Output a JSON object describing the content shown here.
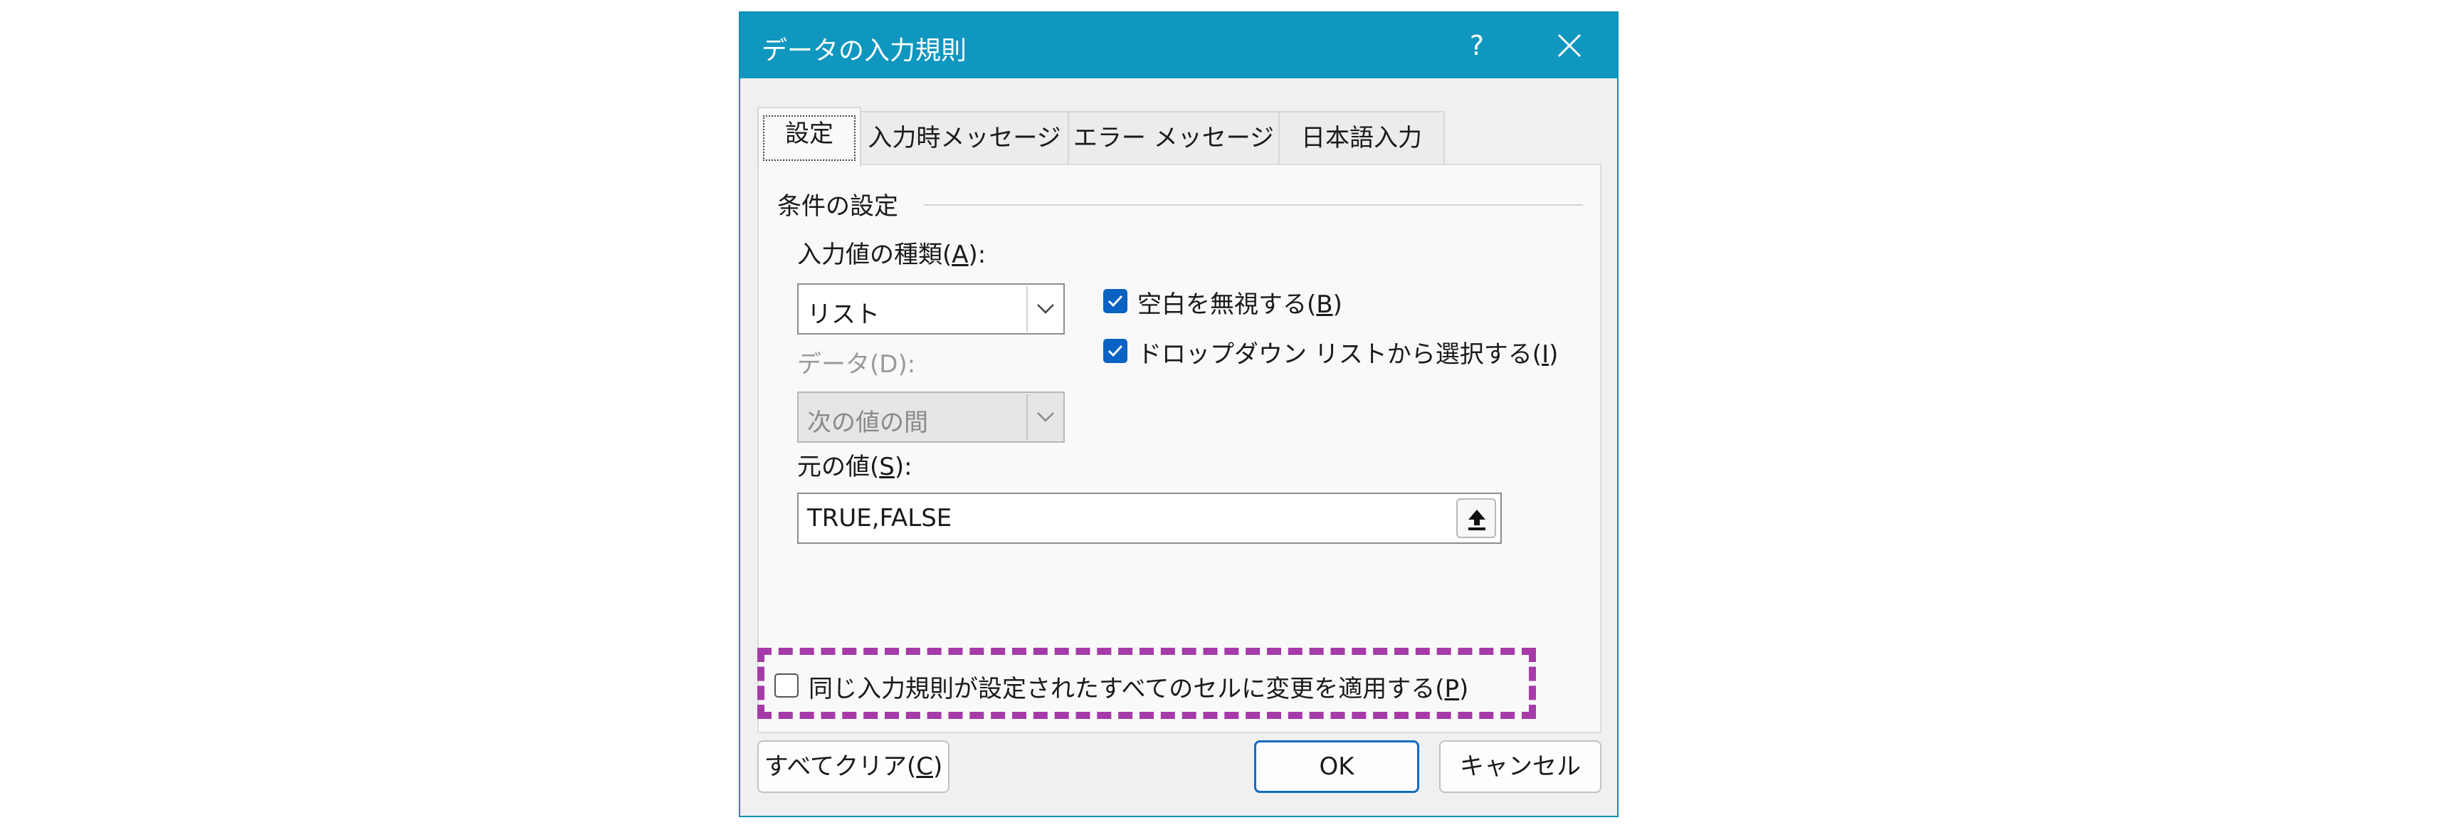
{
  "dialog": {
    "title": "データの入力規則",
    "help_label": "?",
    "close_label": "✕"
  },
  "tabs": [
    {
      "label": "設定",
      "active": true
    },
    {
      "label": "入力時メッセージ",
      "active": false
    },
    {
      "label": "エラー メッセージ",
      "active": false
    },
    {
      "label": "日本語入力",
      "active": false
    }
  ],
  "settings": {
    "group_label": "条件の設定",
    "allow": {
      "label": "入力値の種類(",
      "mnemonic": "A",
      "label_suffix": "):",
      "value": "リスト"
    },
    "data": {
      "label": "データ(D):",
      "value": "次の値の間",
      "disabled": true
    },
    "ignore_blank": {
      "label": "空白を無視する(",
      "mnemonic": "B",
      "label_suffix": ")",
      "checked": true
    },
    "in_cell_dropdown": {
      "label": "ドロップダウン リストから選択する(",
      "mnemonic": "I",
      "label_suffix": ")",
      "checked": true
    },
    "source": {
      "label": "元の値(",
      "mnemonic": "S",
      "label_suffix": "):",
      "value": "TRUE,FALSE"
    },
    "apply_all": {
      "label": "同じ入力規則が設定されたすべてのセルに変更を適用する(",
      "mnemonic": "P",
      "label_suffix": ")",
      "checked": false
    }
  },
  "buttons": {
    "clear_all": {
      "label": "すべてクリア(",
      "mnemonic": "C",
      "label_suffix": ")"
    },
    "ok": "OK",
    "cancel": "キャンセル"
  },
  "colors": {
    "titlebar": "#0f97bf",
    "checkbox_checked": "#0a62c2",
    "highlight": "#a63aa9",
    "primary_border": "#0f6cc0"
  }
}
